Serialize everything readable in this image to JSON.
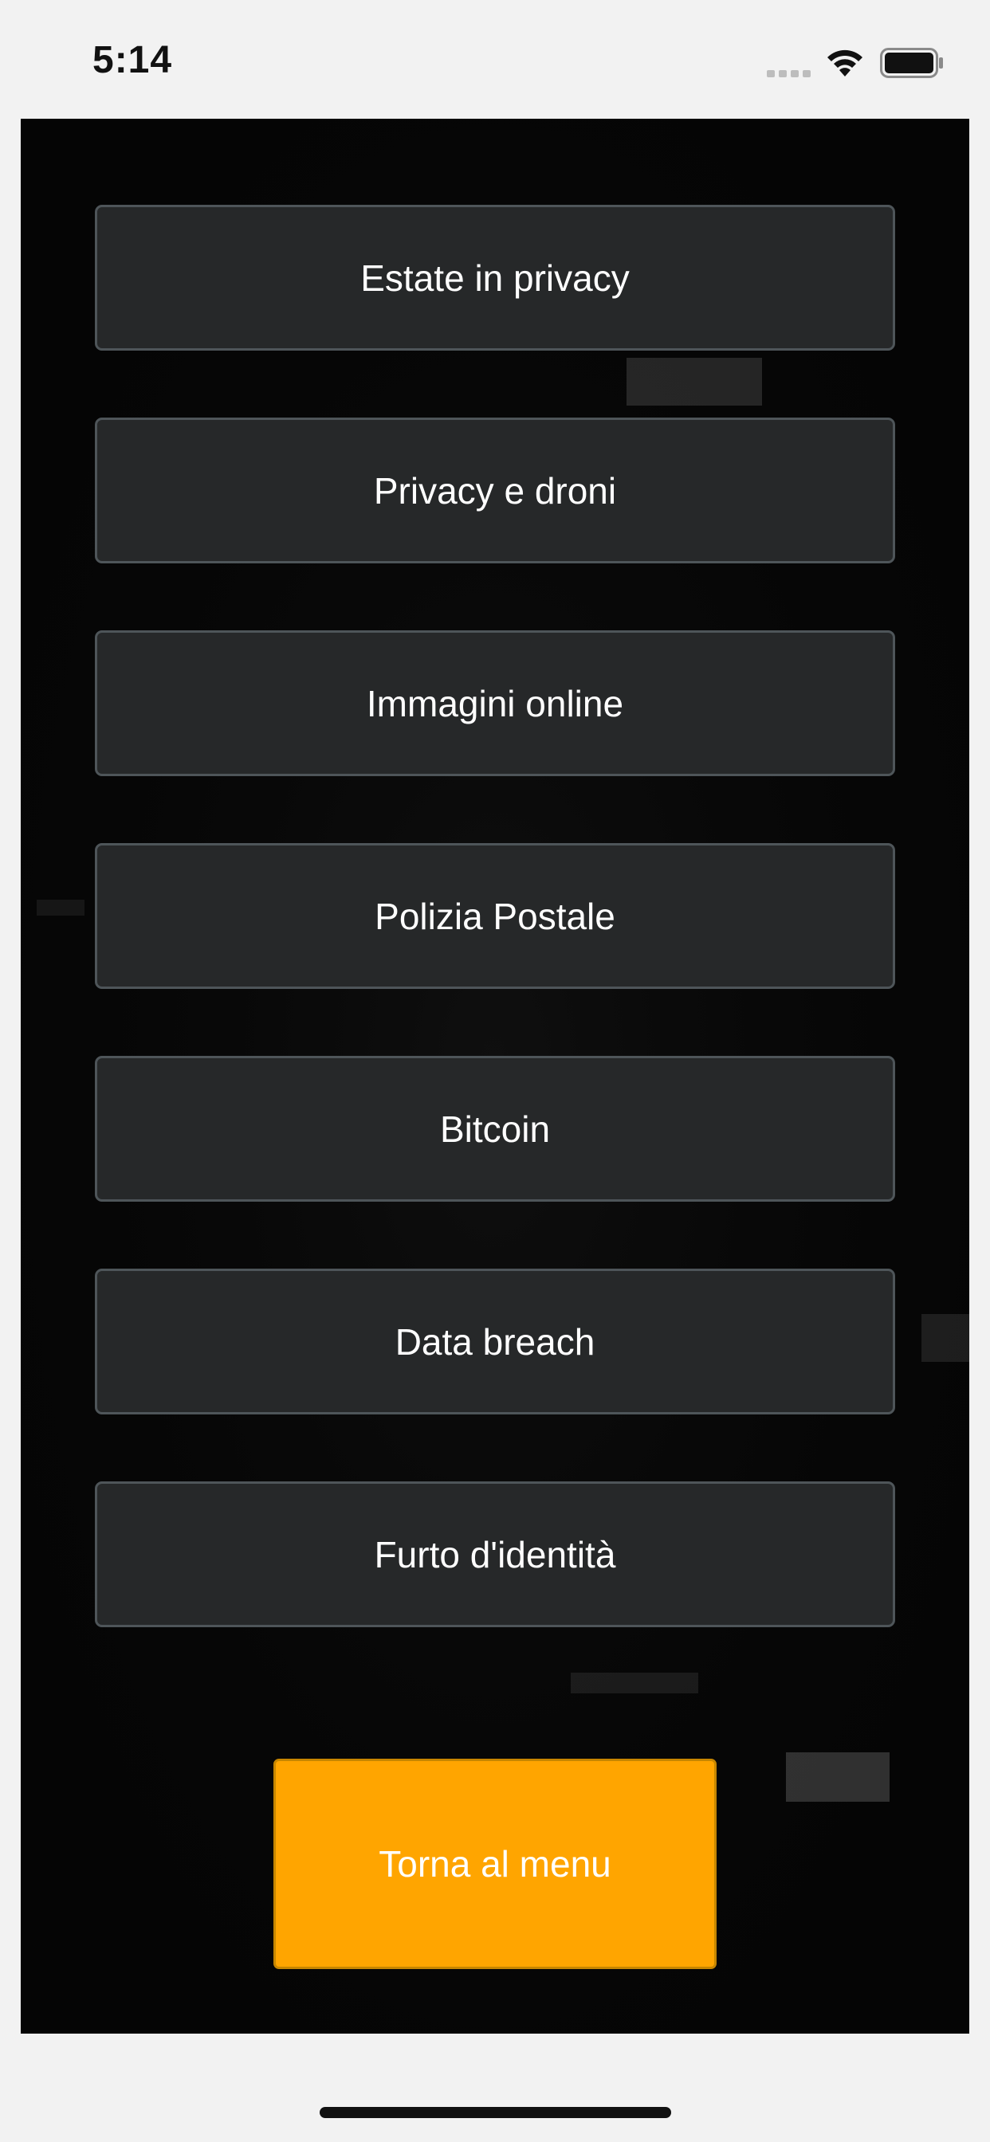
{
  "status_bar": {
    "time": "5:14",
    "icons": [
      "cellular-signal-icon",
      "wifi-icon",
      "battery-icon"
    ]
  },
  "menu": {
    "items": [
      {
        "label": "Estate in privacy"
      },
      {
        "label": "Privacy e droni"
      },
      {
        "label": "Immagini online"
      },
      {
        "label": "Polizia Postale"
      },
      {
        "label": "Bitcoin"
      },
      {
        "label": "Data breach"
      },
      {
        "label": "Furto d'identità"
      }
    ],
    "back_label": "Torna al menu"
  },
  "colors": {
    "background": "#050505",
    "button_fill": "#262829",
    "button_border": "#4e5559",
    "accent": "#ffa500",
    "text": "#ffffff"
  }
}
